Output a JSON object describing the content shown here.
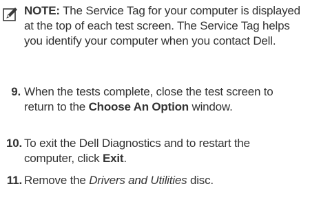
{
  "note": {
    "icon": "pencil-note-icon",
    "label": "NOTE:",
    "text": "The Service Tag for your computer is displayed at the top of each test screen. The Service Tag helps you identify your computer when you contact Dell."
  },
  "steps": [
    {
      "number": "9.",
      "text_before": "When the tests complete, close the test screen to return to the ",
      "bold": "Choose An Option",
      "text_after": " window."
    },
    {
      "number": "10.",
      "text_before": "To exit the Dell Diagnostics and to restart the computer, click ",
      "bold": "Exit",
      "text_after": "."
    },
    {
      "number": "11.",
      "text_before": "Remove the ",
      "italic": "Drivers and Utilities",
      "text_after": " disc."
    }
  ]
}
